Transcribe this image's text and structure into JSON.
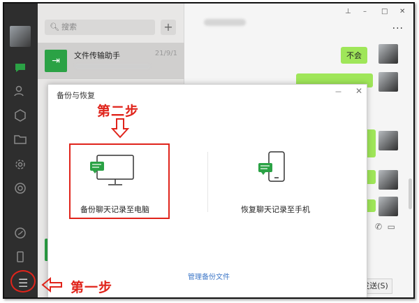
{
  "search": {
    "placeholder": "搜索",
    "add": "+"
  },
  "chats": [
    {
      "name": "文件传输助手",
      "date": "21/9/1"
    }
  ],
  "chat": {
    "bubble1": "不会",
    "send_label": "发送(S)"
  },
  "dialog": {
    "title": "备份与恢复",
    "minimize": "－",
    "close": "✕",
    "option_backup": "备份聊天记录至电脑",
    "option_restore": "恢复聊天记录至手机",
    "manage_link": "管理备份文件"
  },
  "annotations": {
    "step1": "第一步",
    "step2": "第二步",
    "color": "#e0241b"
  },
  "colors": {
    "sidebar": "#2e2e2e",
    "bubble": "#9fe659",
    "accent_green": "#2ba245",
    "link": "#3f78c8"
  },
  "icons": [
    "chat-icon",
    "contacts-icon",
    "favorites-icon",
    "files-icon",
    "settings-gear-icon",
    "moments-icon",
    "mini-program-icon",
    "phone-icon",
    "menu-icon",
    "search-icon",
    "monitor-icon",
    "smartphone-icon"
  ]
}
